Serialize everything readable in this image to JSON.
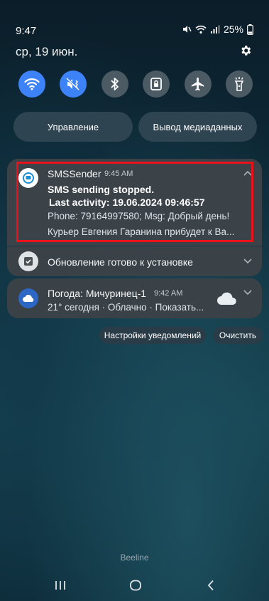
{
  "status_bar": {
    "time": "9:47",
    "battery": "25%"
  },
  "header": {
    "date": "ср, 19 июн."
  },
  "quick_settings": {
    "tiles": [
      {
        "icon": "wifi-icon",
        "active": true
      },
      {
        "icon": "mute-vibrate-icon",
        "active": true
      },
      {
        "icon": "bluetooth-icon",
        "active": false
      },
      {
        "icon": "lock-rotation-icon",
        "active": false
      },
      {
        "icon": "airplane-icon",
        "active": false
      },
      {
        "icon": "flashlight-icon",
        "active": false
      }
    ],
    "device_control_label": "Управление",
    "media_output_label": "Вывод медиаданных"
  },
  "notifications": {
    "sms": {
      "app_name": "SMSSender",
      "time": "9:45 AM",
      "title": "SMS sending stopped.",
      "title_line2": "Last activity: 19.06.2024 09:46:57",
      "body_line1": "Phone: 79164997580; Msg: Добрый день!",
      "body_line2": "Курьер  Евгения  Гаранина прибудет к Ва..."
    },
    "update": {
      "title": "Обновление готово к установке"
    },
    "weather": {
      "title": "Погода: Мичуринец-1",
      "time": "9:42 AM",
      "body": "21° сегодня · Облачно · Показать..."
    }
  },
  "actions": {
    "settings_label": "Настройки уведомлений",
    "clear_label": "Очистить"
  },
  "carrier": "Beeline",
  "colors": {
    "accent": "#3e82f7",
    "highlight": "#e8131a"
  }
}
